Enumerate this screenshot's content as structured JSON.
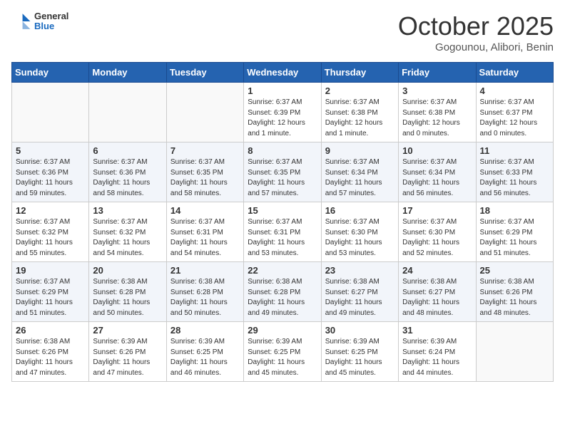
{
  "header": {
    "logo_general": "General",
    "logo_blue": "Blue",
    "month": "October 2025",
    "location": "Gogounou, Alibori, Benin"
  },
  "columns": [
    "Sunday",
    "Monday",
    "Tuesday",
    "Wednesday",
    "Thursday",
    "Friday",
    "Saturday"
  ],
  "weeks": [
    [
      {
        "day": "",
        "info": ""
      },
      {
        "day": "",
        "info": ""
      },
      {
        "day": "",
        "info": ""
      },
      {
        "day": "1",
        "info": "Sunrise: 6:37 AM\nSunset: 6:39 PM\nDaylight: 12 hours\nand 1 minute."
      },
      {
        "day": "2",
        "info": "Sunrise: 6:37 AM\nSunset: 6:38 PM\nDaylight: 12 hours\nand 1 minute."
      },
      {
        "day": "3",
        "info": "Sunrise: 6:37 AM\nSunset: 6:38 PM\nDaylight: 12 hours\nand 0 minutes."
      },
      {
        "day": "4",
        "info": "Sunrise: 6:37 AM\nSunset: 6:37 PM\nDaylight: 12 hours\nand 0 minutes."
      }
    ],
    [
      {
        "day": "5",
        "info": "Sunrise: 6:37 AM\nSunset: 6:36 PM\nDaylight: 11 hours\nand 59 minutes."
      },
      {
        "day": "6",
        "info": "Sunrise: 6:37 AM\nSunset: 6:36 PM\nDaylight: 11 hours\nand 58 minutes."
      },
      {
        "day": "7",
        "info": "Sunrise: 6:37 AM\nSunset: 6:35 PM\nDaylight: 11 hours\nand 58 minutes."
      },
      {
        "day": "8",
        "info": "Sunrise: 6:37 AM\nSunset: 6:35 PM\nDaylight: 11 hours\nand 57 minutes."
      },
      {
        "day": "9",
        "info": "Sunrise: 6:37 AM\nSunset: 6:34 PM\nDaylight: 11 hours\nand 57 minutes."
      },
      {
        "day": "10",
        "info": "Sunrise: 6:37 AM\nSunset: 6:34 PM\nDaylight: 11 hours\nand 56 minutes."
      },
      {
        "day": "11",
        "info": "Sunrise: 6:37 AM\nSunset: 6:33 PM\nDaylight: 11 hours\nand 56 minutes."
      }
    ],
    [
      {
        "day": "12",
        "info": "Sunrise: 6:37 AM\nSunset: 6:32 PM\nDaylight: 11 hours\nand 55 minutes."
      },
      {
        "day": "13",
        "info": "Sunrise: 6:37 AM\nSunset: 6:32 PM\nDaylight: 11 hours\nand 54 minutes."
      },
      {
        "day": "14",
        "info": "Sunrise: 6:37 AM\nSunset: 6:31 PM\nDaylight: 11 hours\nand 54 minutes."
      },
      {
        "day": "15",
        "info": "Sunrise: 6:37 AM\nSunset: 6:31 PM\nDaylight: 11 hours\nand 53 minutes."
      },
      {
        "day": "16",
        "info": "Sunrise: 6:37 AM\nSunset: 6:30 PM\nDaylight: 11 hours\nand 53 minutes."
      },
      {
        "day": "17",
        "info": "Sunrise: 6:37 AM\nSunset: 6:30 PM\nDaylight: 11 hours\nand 52 minutes."
      },
      {
        "day": "18",
        "info": "Sunrise: 6:37 AM\nSunset: 6:29 PM\nDaylight: 11 hours\nand 51 minutes."
      }
    ],
    [
      {
        "day": "19",
        "info": "Sunrise: 6:37 AM\nSunset: 6:29 PM\nDaylight: 11 hours\nand 51 minutes."
      },
      {
        "day": "20",
        "info": "Sunrise: 6:38 AM\nSunset: 6:28 PM\nDaylight: 11 hours\nand 50 minutes."
      },
      {
        "day": "21",
        "info": "Sunrise: 6:38 AM\nSunset: 6:28 PM\nDaylight: 11 hours\nand 50 minutes."
      },
      {
        "day": "22",
        "info": "Sunrise: 6:38 AM\nSunset: 6:28 PM\nDaylight: 11 hours\nand 49 minutes."
      },
      {
        "day": "23",
        "info": "Sunrise: 6:38 AM\nSunset: 6:27 PM\nDaylight: 11 hours\nand 49 minutes."
      },
      {
        "day": "24",
        "info": "Sunrise: 6:38 AM\nSunset: 6:27 PM\nDaylight: 11 hours\nand 48 minutes."
      },
      {
        "day": "25",
        "info": "Sunrise: 6:38 AM\nSunset: 6:26 PM\nDaylight: 11 hours\nand 48 minutes."
      }
    ],
    [
      {
        "day": "26",
        "info": "Sunrise: 6:38 AM\nSunset: 6:26 PM\nDaylight: 11 hours\nand 47 minutes."
      },
      {
        "day": "27",
        "info": "Sunrise: 6:39 AM\nSunset: 6:26 PM\nDaylight: 11 hours\nand 47 minutes."
      },
      {
        "day": "28",
        "info": "Sunrise: 6:39 AM\nSunset: 6:25 PM\nDaylight: 11 hours\nand 46 minutes."
      },
      {
        "day": "29",
        "info": "Sunrise: 6:39 AM\nSunset: 6:25 PM\nDaylight: 11 hours\nand 45 minutes."
      },
      {
        "day": "30",
        "info": "Sunrise: 6:39 AM\nSunset: 6:25 PM\nDaylight: 11 hours\nand 45 minutes."
      },
      {
        "day": "31",
        "info": "Sunrise: 6:39 AM\nSunset: 6:24 PM\nDaylight: 11 hours\nand 44 minutes."
      },
      {
        "day": "",
        "info": ""
      }
    ]
  ]
}
